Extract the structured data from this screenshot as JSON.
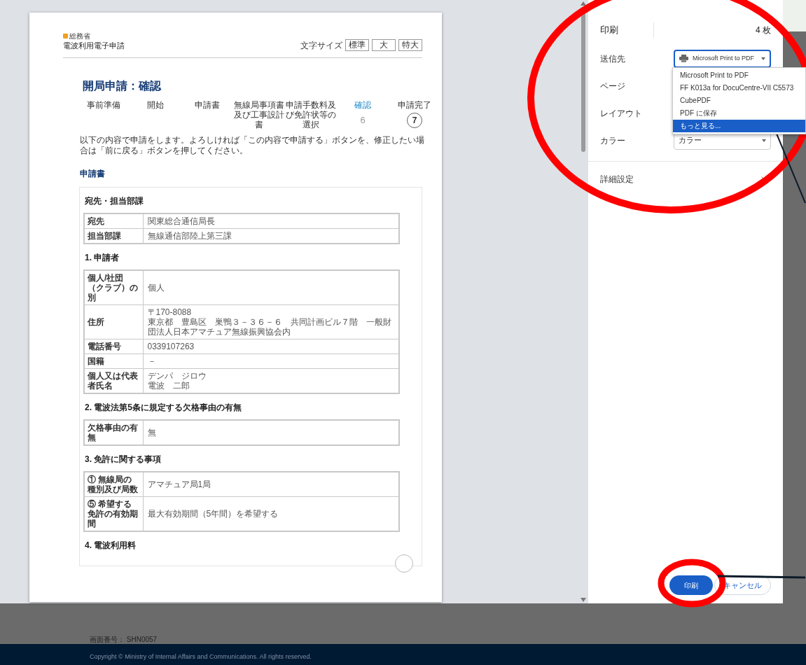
{
  "document": {
    "ministry": "総務省",
    "site_title": "電波利用電子申請",
    "font_size": {
      "label": "文字サイズ",
      "options": [
        {
          "label": "標準"
        },
        {
          "label": "大"
        },
        {
          "label": "特大"
        }
      ]
    },
    "page_title": "開局申請：確認",
    "steps": [
      {
        "label": "事前準備",
        "selected": false
      },
      {
        "label": "開始",
        "selected": false
      },
      {
        "label": "申請書",
        "selected": false
      },
      {
        "label": "無線局事項書及び工事設計書",
        "selected": false
      },
      {
        "label": "申請手数料及び免許状等の選択",
        "selected": false
      },
      {
        "label": "確認",
        "number": "6",
        "selected": true
      },
      {
        "label": "申請完了",
        "number": "7",
        "selected": false
      }
    ],
    "instruction": "以下の内容で申請をします。よろしければ「この内容で申請する」ボタンを、修正したい場合は「前に戻る」ボタンを押してください。",
    "form_heading": "申請書",
    "sections": [
      {
        "heading": "宛先・担当部課",
        "rows": [
          {
            "label": "宛先",
            "value": "関東総合通信局長"
          },
          {
            "label": "担当部課",
            "value": "無線通信部陸上第三課"
          }
        ]
      },
      {
        "heading": "1. 申請者",
        "rows": [
          {
            "label": "個人/社団（クラブ）の別",
            "value": "個人"
          },
          {
            "label": "住所",
            "lines": [
              "〒170-8088",
              "東京都　豊島区　巣鴨３－３６－６　共同計画ビル７階　一般財団法人日本アマチュア無線振興協会内"
            ]
          },
          {
            "label": "電話番号",
            "value": "0339107263"
          },
          {
            "label": "国籍",
            "value": "－"
          },
          {
            "label": "個人又は代表者氏名",
            "lines": [
              "デンパ　ジロウ",
              "電波　二郎"
            ]
          }
        ]
      },
      {
        "heading": "2. 電波法第5条に規定する欠格事由の有無",
        "rows": [
          {
            "label": "欠格事由の有無",
            "value": "無"
          }
        ]
      },
      {
        "heading": "3. 免許に関する事項",
        "rows": [
          {
            "label": "① 無線局の種別及び局数",
            "value": "アマチュア局1局"
          },
          {
            "label": "⑤ 希望する免許の有効期間",
            "value": "最大有効期間（5年間）を希望する"
          }
        ]
      },
      {
        "heading": "4. 電波利用料"
      }
    ]
  },
  "print_dialog": {
    "title": "印刷",
    "sheet_count": "4 枚",
    "settings": [
      {
        "label": "送信先",
        "kind": "printer",
        "value": "Microsoft Print to PDF"
      },
      {
        "label": "ページ",
        "kind": "covered"
      },
      {
        "label": "レイアウト",
        "kind": "covered"
      },
      {
        "label": "カラー",
        "kind": "select",
        "value": "カラー"
      }
    ],
    "destination_menu": [
      {
        "label": "Microsoft Print to PDF",
        "selected": false
      },
      {
        "label": "FF K013a for DocuCentre-VII C5573",
        "selected": false
      },
      {
        "label": "CubePDF",
        "selected": false
      },
      {
        "label": "PDF に保存",
        "selected": false
      },
      {
        "label": "もっと見る...",
        "selected": true
      }
    ],
    "more_settings": "詳細設定",
    "buttons": [
      {
        "label": "印刷",
        "kind": "primary"
      },
      {
        "label": "キャンセル",
        "kind": "secondary"
      }
    ]
  },
  "footer": {
    "screen_number": "画面番号： SHN0057",
    "copyright": "Copyright © Ministry of Internal Affairs and Communications. All rights reserved."
  }
}
